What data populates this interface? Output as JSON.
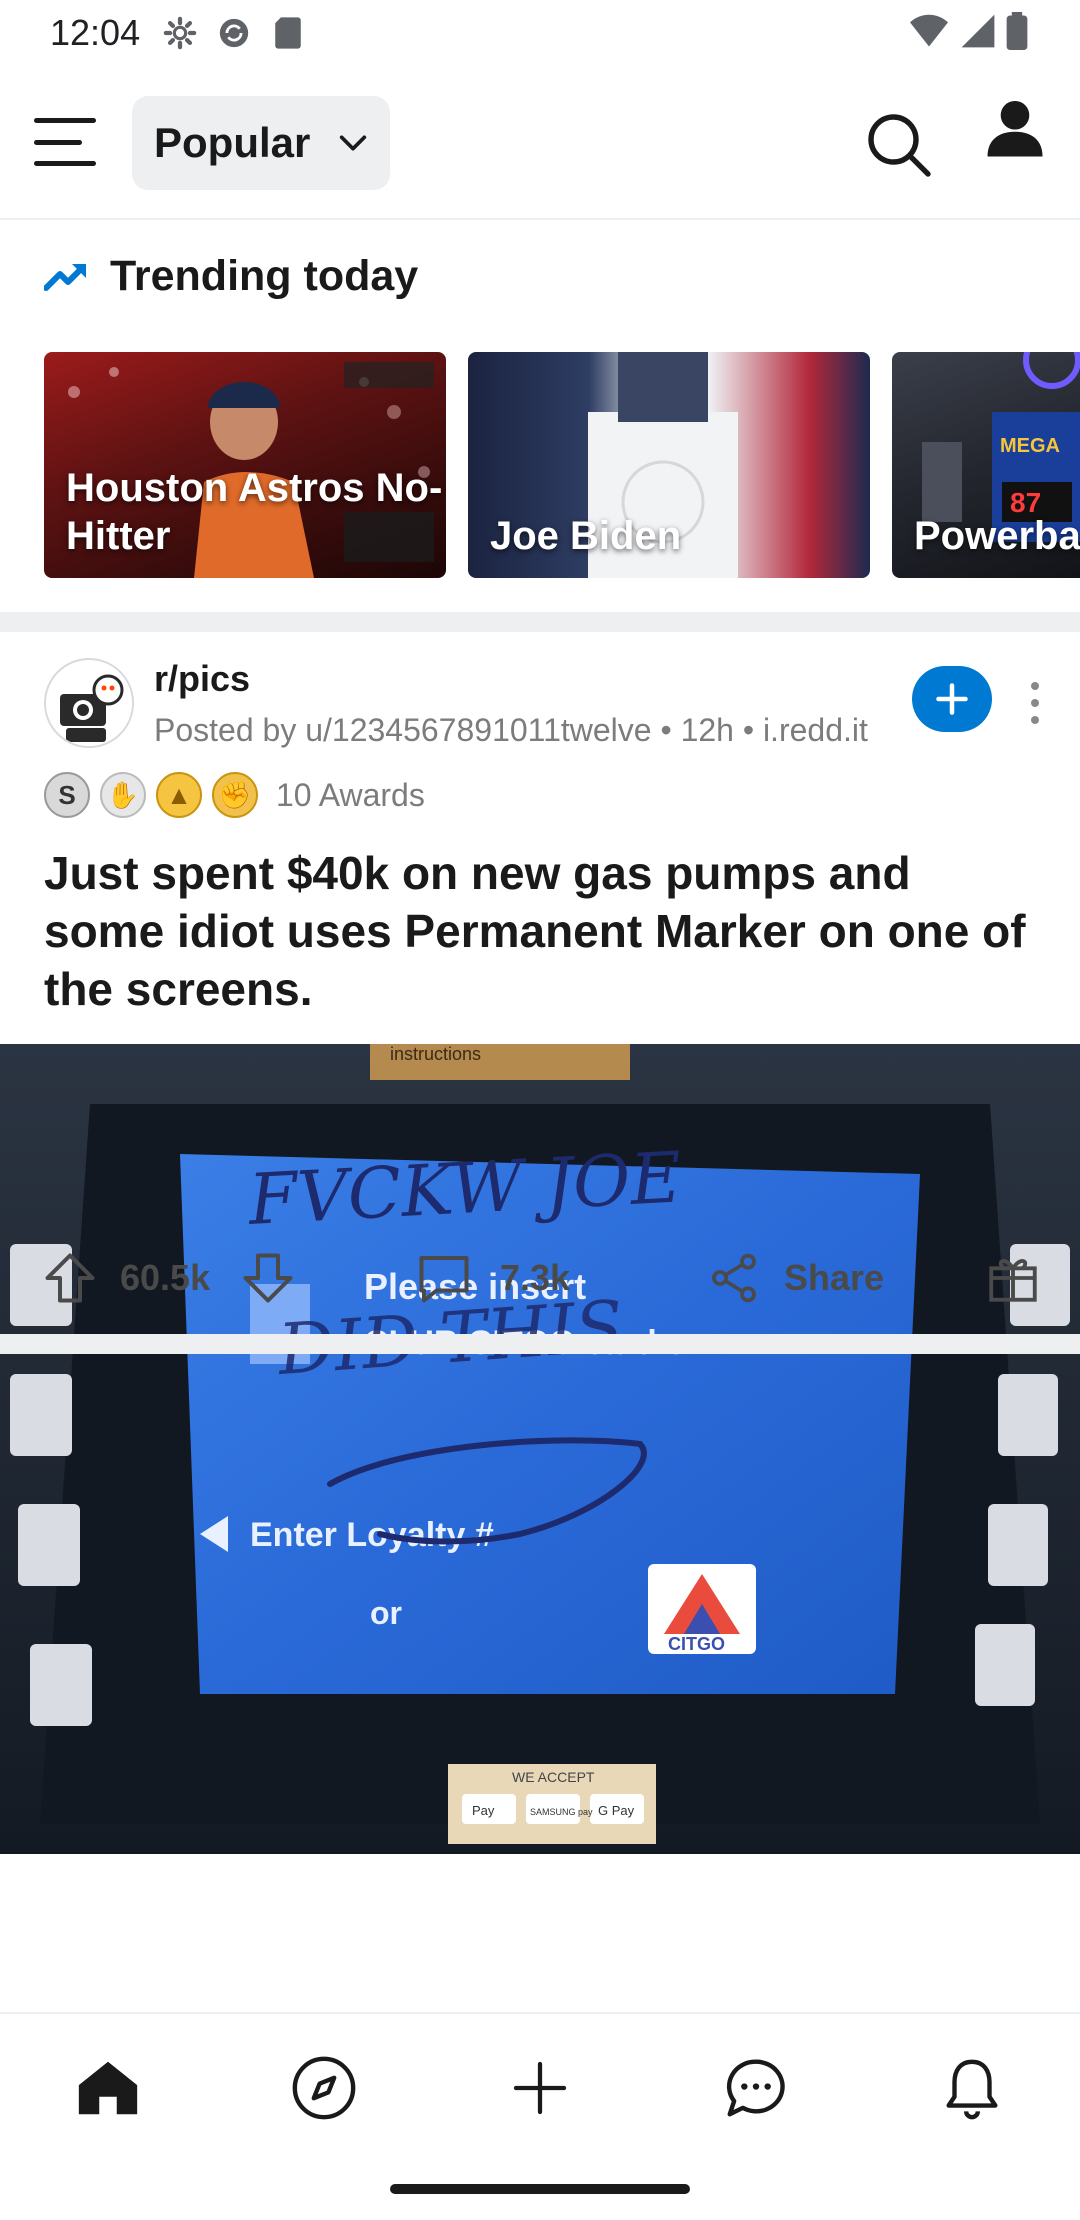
{
  "status_bar": {
    "time": "12:04"
  },
  "header": {
    "feed_label": "Popular",
    "icons": [
      "menu-icon",
      "chevron-down-icon",
      "search-icon",
      "profile-icon"
    ]
  },
  "trending": {
    "title": "Trending today",
    "cards": [
      {
        "label": "Houston Astros No-Hitter"
      },
      {
        "label": "Joe Biden"
      },
      {
        "label": "Powerba"
      }
    ]
  },
  "post": {
    "subreddit": "r/pics",
    "author_line": "Posted by u/1234567891011twelve • 12h • i.redd.it",
    "awards_count": "10 Awards",
    "title": "Just spent $40k on new gas pumps and some idiot uses Permanent Marker on one of the screens.",
    "image": {
      "screen_text_1": "Please insert",
      "screen_text_2": "CLUB CITGO card or",
      "screen_text_3": "Enter Loyalty #",
      "screen_text_4": "or",
      "handwriting_1": "FVCKW JOE",
      "handwriting_2": "DID THIS",
      "brand": "CITGO",
      "top_label": "instructions",
      "accept_label": "WE ACCEPT",
      "pay_1": "Pay",
      "pay_2": "SAMSUNG pay",
      "pay_3": "G Pay"
    },
    "upvotes": "60.5k",
    "comments": "7.3k",
    "share_label": "Share"
  },
  "bottom_nav": {
    "items": [
      "home-icon",
      "discover-icon",
      "create-icon",
      "chat-icon",
      "notifications-icon"
    ]
  },
  "colors": {
    "accent": "#0079d3",
    "text": "#1a1a1b",
    "meta": "#7c7c7c",
    "divider": "#edeff1"
  }
}
